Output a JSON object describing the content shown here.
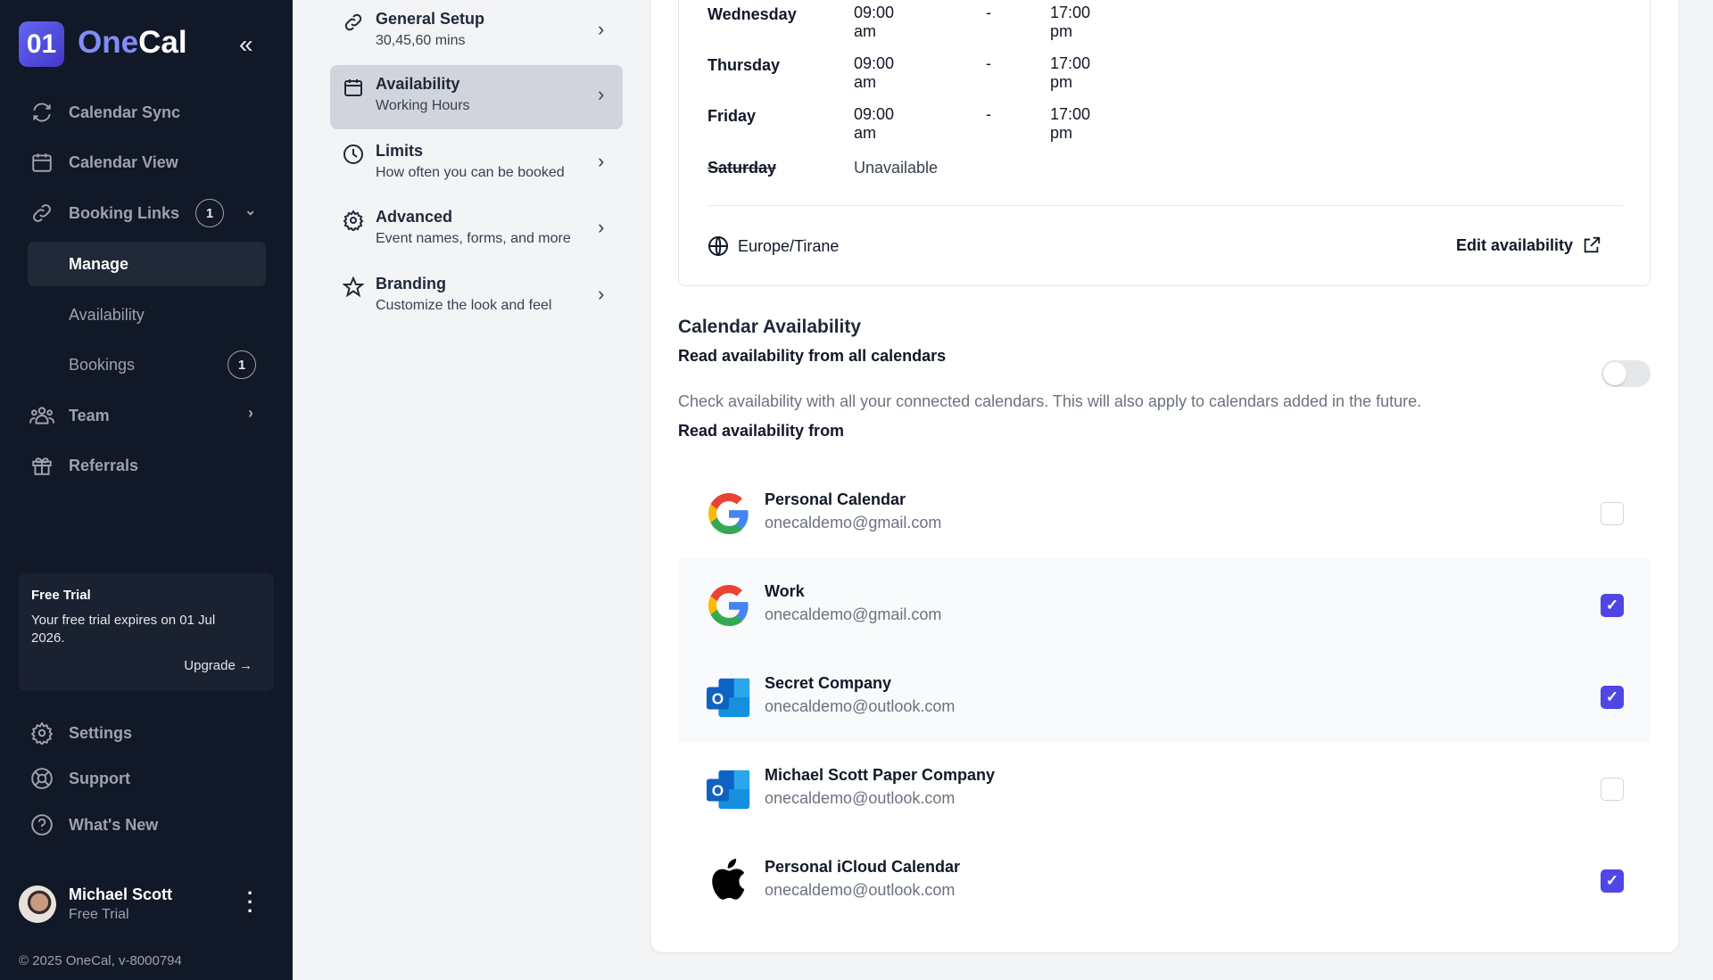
{
  "sidebar": {
    "logo_mark": "01",
    "brand_a": "One",
    "brand_b": "Cal",
    "items": [
      {
        "label": "Calendar Sync",
        "icon": "sync-icon"
      },
      {
        "label": "Calendar View",
        "icon": "calendar-icon"
      },
      {
        "label": "Booking Links",
        "icon": "link-icon",
        "badge": "1"
      },
      {
        "label": "Manage"
      },
      {
        "label": "Availability"
      },
      {
        "label": "Bookings",
        "badge": "1"
      },
      {
        "label": "Team",
        "icon": "team-icon"
      },
      {
        "label": "Referrals",
        "icon": "gift-icon"
      }
    ],
    "trial": {
      "title": "Free Trial",
      "text": "Your free trial expires on 01 Jul 2026.",
      "upgrade": "Upgrade →"
    },
    "bottom": [
      {
        "label": "Settings"
      },
      {
        "label": "Support"
      },
      {
        "label": "What's New"
      }
    ],
    "user": {
      "name": "Michael Scott",
      "plan": "Free Trial"
    },
    "footer": "© 2025 OneCal, v-8000794"
  },
  "settings_menu": [
    {
      "title": "General Setup",
      "subtitle": "30,45,60 mins"
    },
    {
      "title": "Availability",
      "subtitle": "Working Hours"
    },
    {
      "title": "Limits",
      "subtitle": "How often you can be booked"
    },
    {
      "title": "Advanced",
      "subtitle": "Event names, forms, and more"
    },
    {
      "title": "Branding",
      "subtitle": "Customize the look and feel"
    }
  ],
  "hours": {
    "days": [
      {
        "day": "Wednesday",
        "start": "09:00 am",
        "sep": "-",
        "end": "17:00 pm"
      },
      {
        "day": "Thursday",
        "start": "09:00 am",
        "sep": "-",
        "end": "17:00 pm"
      },
      {
        "day": "Friday",
        "start": "09:00 am",
        "sep": "-",
        "end": "17:00 pm"
      },
      {
        "day": "Saturday",
        "status": "Unavailable"
      }
    ],
    "timezone": "Europe/Tirane",
    "edit": "Edit availability"
  },
  "calendar_availability": {
    "heading": "Calendar Availability",
    "all_label": "Read availability from all calendars",
    "all_desc": "Check availability with all your connected calendars. This will also apply to calendars added in the future.",
    "all_enabled": false,
    "from_label": "Read availability from",
    "calendars": [
      {
        "name": "Personal Calendar",
        "email": "onecaldemo@gmail.com",
        "provider": "google",
        "checked": false
      },
      {
        "name": "Work",
        "email": "onecaldemo@gmail.com",
        "provider": "google",
        "checked": true
      },
      {
        "name": "Secret Company",
        "email": "onecaldemo@outlook.com",
        "provider": "outlook",
        "checked": true
      },
      {
        "name": "Michael Scott Paper Company",
        "email": "onecaldemo@outlook.com",
        "provider": "outlook",
        "checked": false
      },
      {
        "name": "Personal iCloud Calendar",
        "email": "onecaldemo@outlook.com",
        "provider": "apple",
        "checked": true
      }
    ]
  },
  "colors": {
    "accent": "#4f46e5",
    "sidebar": "#111827"
  }
}
